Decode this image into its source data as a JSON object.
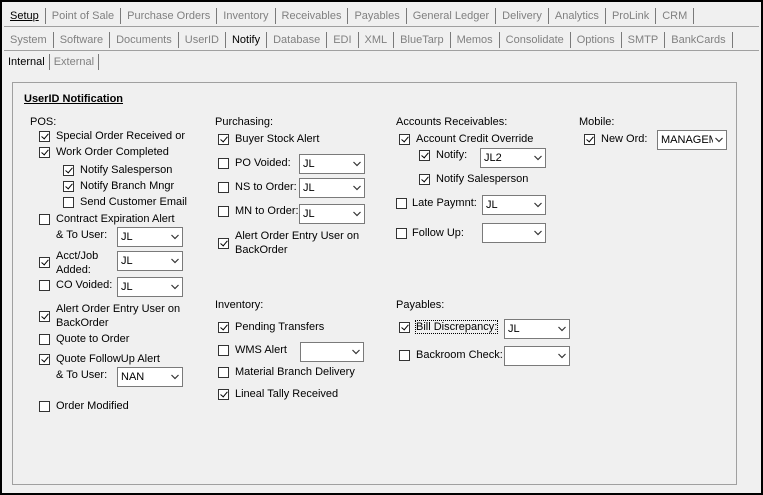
{
  "tabs_row1": [
    "Setup",
    "Point of Sale",
    "Purchase Orders",
    "Inventory",
    "Receivables",
    "Payables",
    "General Ledger",
    "Delivery",
    "Analytics",
    "ProLink",
    "CRM"
  ],
  "tabs_row2": [
    "System",
    "Software",
    "Documents",
    "UserID",
    "Notify",
    "Database",
    "EDI",
    "XML",
    "BlueTarp",
    "Memos",
    "Consolidate",
    "Options",
    "SMTP",
    "BankCards"
  ],
  "tabs_row3": [
    "Internal",
    "External"
  ],
  "panel_title": "UserID Notification",
  "pos": {
    "header": "POS:",
    "special_order": "Special Order Received or",
    "work_order": "Work Order Completed",
    "notify_salesperson": "Notify Salesperson",
    "notify_branch": "Notify Branch Mngr",
    "send_customer_email": "Send Customer Email",
    "contract_exp": "Contract Expiration Alert",
    "to_user": "& To User:",
    "contract_user": "JL",
    "acct_job_1": "Acct/Job",
    "acct_job_2": "Added:",
    "acct_job_user": "JL",
    "co_voided": "CO Voided:",
    "co_voided_user": "JL",
    "alert_order_1": "Alert Order Entry User on",
    "alert_order_2": "BackOrder",
    "quote_to_order": "Quote to Order",
    "quote_followup": "Quote FollowUp Alert",
    "quote_to_user": "& To User:",
    "quote_user": "NAN",
    "order_modified": "Order Modified"
  },
  "purchasing": {
    "header": "Purchasing:",
    "buyer_stock": "Buyer Stock Alert",
    "po_voided": "PO Voided:",
    "po_voided_user": "JL",
    "ns_to_order": "NS to Order:",
    "ns_user": "JL",
    "mn_to_order": "MN to Order:",
    "mn_user": "JL",
    "alert_order_1": "Alert Order Entry User on",
    "alert_order_2": "BackOrder"
  },
  "ar": {
    "header": "Accounts Receivables:",
    "credit_override": "Account Credit Override",
    "notify": "Notify:",
    "notify_user": "JL2",
    "notify_salesperson": "Notify Salesperson",
    "late_paymnt": "Late Paymnt:",
    "late_user": "JL",
    "follow_up": "Follow Up:",
    "follow_user": ""
  },
  "mobile": {
    "header": "Mobile:",
    "new_ord": "New Ord:",
    "new_ord_user": "MANAGEM"
  },
  "inventory": {
    "header": "Inventory:",
    "pending_transfers": "Pending Transfers",
    "wms_alert": "WMS Alert",
    "wms_user": "",
    "material_branch": "Material Branch Delivery",
    "lineal_tally": "Lineal Tally Received"
  },
  "payables": {
    "header": "Payables:",
    "bill_discrepancy": "Bill Discrepancy:",
    "bill_user": "JL",
    "backroom_check": "Backroom Check:",
    "backroom_user": ""
  }
}
